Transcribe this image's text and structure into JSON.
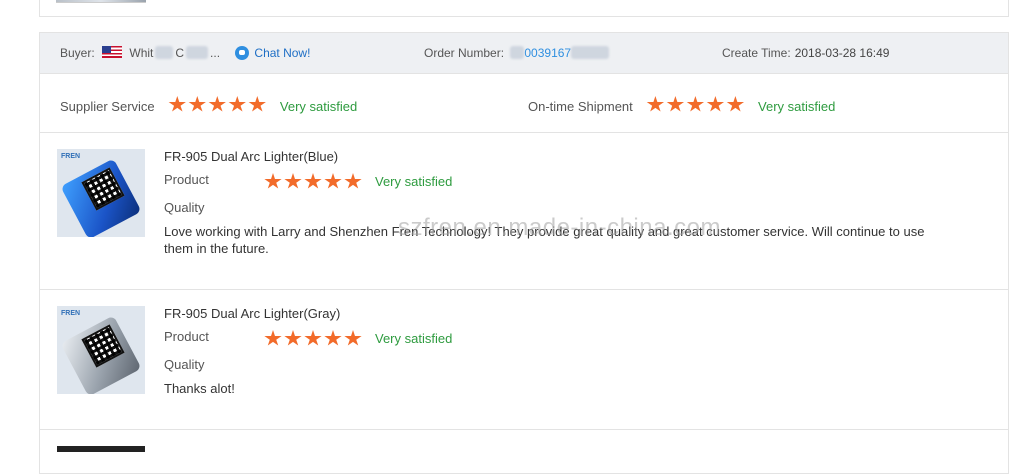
{
  "order": {
    "buyer_label": "Buyer:",
    "buyer_name_start": "Whit",
    "buyer_name_mid": "C",
    "buyer_name_end": "...",
    "chat_label": "Chat Now!",
    "order_number_label": "Order Number:",
    "order_number_visible": "0039167",
    "create_time_label": "Create Time:",
    "create_time_value": "2018-03-28 16:49"
  },
  "supplier_rating": {
    "service_label": "Supplier Service",
    "service_stars": 5,
    "service_text": "Very satisfied",
    "shipment_label": "On-time Shipment",
    "shipment_stars": 5,
    "shipment_text": "Very satisfied"
  },
  "items": [
    {
      "title": "FR-905 Dual Arc Lighter(Blue)",
      "product_label": "Product",
      "quality_label": "Quality",
      "stars": 5,
      "rating_text": "Very satisfied",
      "comment": "Love working with Larry and Shenzhen Fren Technology! They provide great quality and great customer service. Will continue to use them in the future.",
      "thumb_brand": "FREN",
      "color": "blue"
    },
    {
      "title": "FR-905 Dual Arc Lighter(Gray)",
      "product_label": "Product",
      "quality_label": "Quality",
      "stars": 5,
      "rating_text": "Very satisfied",
      "comment": "Thanks alot!",
      "thumb_brand": "FREN",
      "color": "gray"
    }
  ],
  "watermark": "szfren.en.made-in-china.com",
  "colors": {
    "star": "#f26b2a",
    "satisfied": "#2e9b3f",
    "link": "#1f6fc5",
    "header_bg": "#eef0f3"
  }
}
